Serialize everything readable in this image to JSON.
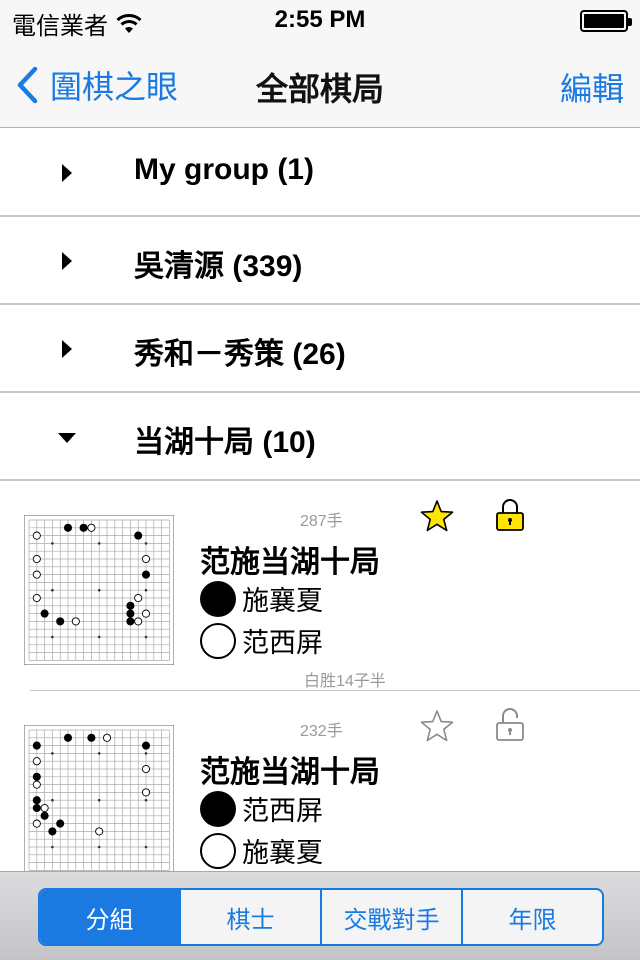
{
  "status_bar": {
    "carrier": "電信業者",
    "time": "2:55 PM",
    "battery_level": 1.0
  },
  "nav": {
    "back_label": "圍棋之眼",
    "title": "全部棋局",
    "edit_label": "編輯"
  },
  "groups": [
    {
      "label": "My group (1)",
      "expanded": false
    },
    {
      "label": "吳清源 (339)",
      "expanded": false
    },
    {
      "label": "秀和－秀策 (26)",
      "expanded": false
    },
    {
      "label": "当湖十局 (10)",
      "expanded": true
    }
  ],
  "games": [
    {
      "moves": "287手",
      "starred": true,
      "locked": true,
      "title": "范施当湖十局",
      "black_player": "施襄夏",
      "white_player": "范西屏",
      "result": "白胜14子半"
    },
    {
      "moves": "232手",
      "starred": false,
      "locked": false,
      "title": "范施当湖十局",
      "black_player": "范西屏",
      "white_player": "施襄夏",
      "result": ""
    }
  ],
  "tabs": [
    {
      "label": "分組",
      "active": true
    },
    {
      "label": "棋士",
      "active": false
    },
    {
      "label": "交戰對手",
      "active": false
    },
    {
      "label": "年限",
      "active": false
    }
  ],
  "colors": {
    "accent": "#1a7ae2",
    "star_fill": "#ffe600",
    "lock_fill": "#ffe600"
  },
  "icons": [
    "wifi-icon",
    "battery-icon",
    "chevron-back-icon",
    "disclosure-right-icon",
    "disclosure-down-icon",
    "star-icon",
    "lock-icon",
    "unlock-icon",
    "go-board-thumbnail"
  ]
}
